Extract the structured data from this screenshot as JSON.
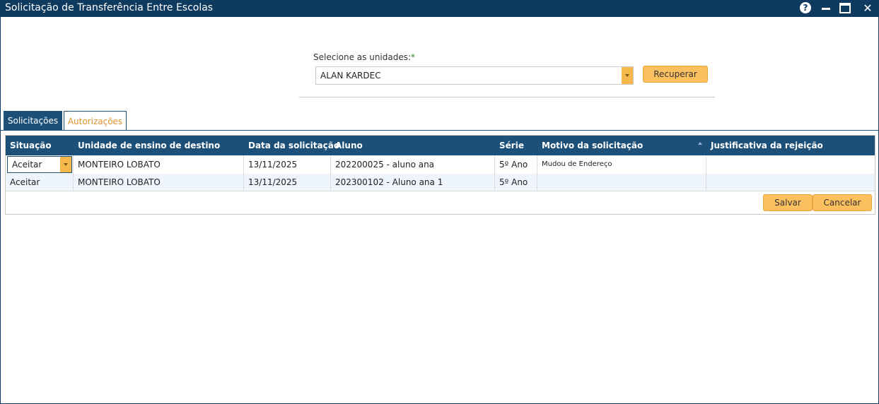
{
  "window": {
    "title": "Solicitação de Transferência Entre Escolas",
    "help_glyph": "?",
    "close_glyph": "✕"
  },
  "form": {
    "unit_label": "Selecione as unidades:",
    "required_mark": "*",
    "unit_value": "ALAN KARDEC",
    "recuperar_label": "Recuperar"
  },
  "tabs": [
    {
      "label": "Solicitações",
      "active": false
    },
    {
      "label": "Autorizações",
      "active": true
    }
  ],
  "grid": {
    "columns": [
      "Situação",
      "Unidade de ensino de destino",
      "Data da solicitação",
      "Aluno",
      "Série",
      "Motivo da solicitação",
      "Justificativa da rejeição"
    ],
    "rows": [
      {
        "situacao": "Aceitar",
        "unidade": "MONTEIRO LOBATO",
        "data": "13/11/2025",
        "aluno": "202200025 - aluno ana",
        "serie": "5º Ano",
        "motivo": "Mudou de Endereço",
        "justificativa": ""
      },
      {
        "situacao": "Aceitar",
        "unidade": "MONTEIRO LOBATO",
        "data": "13/11/2025",
        "aluno": "202300102 - Aluno ana 1",
        "serie": "5º Ano",
        "motivo": "",
        "justificativa": ""
      }
    ],
    "salvar_label": "Salvar",
    "cancelar_label": "Cancelar"
  },
  "colors": {
    "titlebar": "#0f3a5f",
    "header": "#1d5079",
    "accent_button": "#fdc05f",
    "active_tab_text": "#e0922c"
  }
}
